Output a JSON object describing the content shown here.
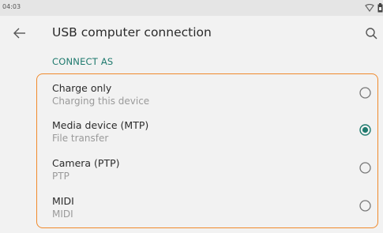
{
  "status_bar": {
    "time": "04:03",
    "icons": [
      "wifi-icon",
      "battery-icon"
    ]
  },
  "app_bar": {
    "title": "USB computer connection",
    "back_icon": "arrow-left-icon",
    "search_icon": "search-icon"
  },
  "section": {
    "header": "CONNECT AS"
  },
  "options": [
    {
      "title": "Charge only",
      "subtitle": "Charging this device",
      "selected": false
    },
    {
      "title": "Media device (MTP)",
      "subtitle": "File transfer",
      "selected": true
    },
    {
      "title": "Camera (PTP)",
      "subtitle": "PTP",
      "selected": false
    },
    {
      "title": "MIDI",
      "subtitle": "MIDI",
      "selected": false
    }
  ],
  "colors": {
    "accent": "#1f7a6e",
    "highlight_border": "#f08a2c"
  }
}
